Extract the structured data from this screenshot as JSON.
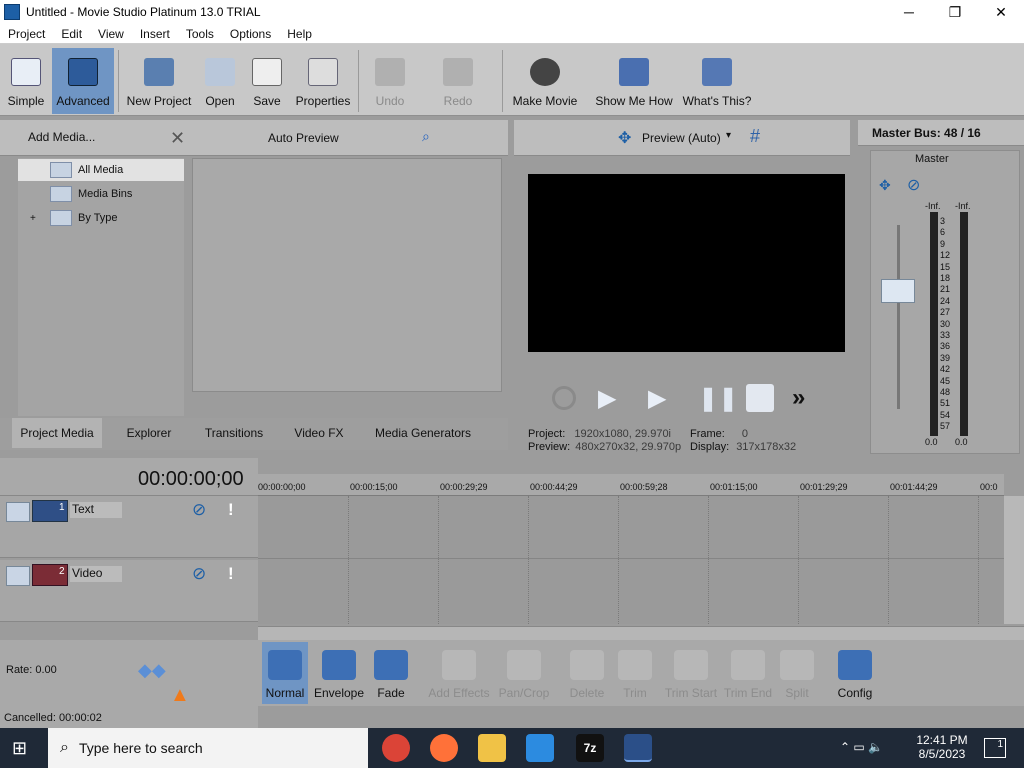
{
  "window": {
    "title": "Untitled - Movie Studio Platinum 13.0 TRIAL",
    "minimize": "─",
    "maximize": "❐",
    "close": "✕"
  },
  "menu": [
    "Project",
    "Edit",
    "View",
    "Insert",
    "Tools",
    "Options",
    "Help"
  ],
  "toolbar": {
    "simple": "Simple",
    "advanced": "Advanced",
    "new_project": "New Project",
    "open": "Open",
    "save": "Save",
    "properties": "Properties",
    "undo": "Undo",
    "redo": "Redo",
    "make_movie": "Make Movie",
    "show_me_how": "Show Me How",
    "whats_this": "What's This?"
  },
  "media_panel": {
    "add_media": "Add Media...",
    "auto_preview": "Auto Preview",
    "tree": [
      "All Media",
      "Media Bins",
      "By Type"
    ],
    "tabs": [
      "Project Media",
      "Explorer",
      "Transitions",
      "Video FX",
      "Media Generators"
    ]
  },
  "preview": {
    "mode": "Preview (Auto)",
    "project_label": "Project:",
    "project_value": "1920x1080, 29.970i",
    "frame_label": "Frame:",
    "frame_value": "0",
    "preview_label": "Preview:",
    "preview_value": "480x270x32, 29.970p",
    "display_label": "Display:",
    "display_value": "317x178x32"
  },
  "master": {
    "title": "Master Bus: 48 / 16",
    "label": "Master",
    "inf_left": "-Inf.",
    "inf_right": "-Inf.",
    "scale": [
      "3",
      "6",
      "9",
      "12",
      "15",
      "18",
      "21",
      "24",
      "27",
      "30",
      "33",
      "36",
      "39",
      "42",
      "45",
      "48",
      "51",
      "54",
      "57"
    ],
    "left_val": "0.0",
    "right_val": "0.0"
  },
  "timeline": {
    "timecode": "00:00:00;00",
    "ruler": [
      "00:00:00;00",
      "00:00:15;00",
      "00:00:29;29",
      "00:00:44;29",
      "00:00:59;28",
      "00:01:15;00",
      "00:01:29;29",
      "00:01:44;29",
      "00:0"
    ],
    "tracks": [
      {
        "num": "1",
        "name": "Text"
      },
      {
        "num": "2",
        "name": "Video"
      }
    ]
  },
  "bottom": {
    "rate": "Rate: 0.00",
    "status": "Cancelled: 00:00:02",
    "tools": [
      "Normal",
      "Envelope",
      "Fade",
      "Add Effects",
      "Pan/Crop",
      "Delete",
      "Trim",
      "Trim Start",
      "Trim End",
      "Split",
      "Config"
    ]
  },
  "taskbar": {
    "search": "Type here to search",
    "time": "12:41 PM",
    "date": "8/5/2023",
    "notif": "1"
  },
  "colors": {
    "accent": "#4a8fd6",
    "preview_bg": "#000000",
    "panel": "#a4a4a4",
    "toolbar": "#c8c8c8"
  }
}
